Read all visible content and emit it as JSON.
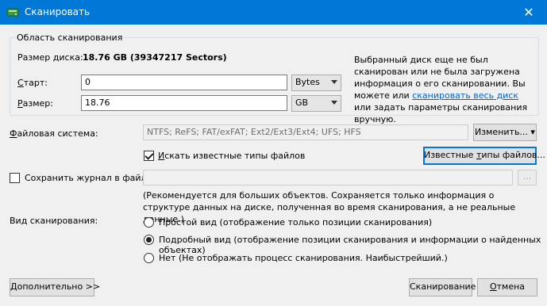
{
  "window": {
    "title": "Сканировать",
    "close_glyph": "✕"
  },
  "group": {
    "legend": "Область сканирования"
  },
  "disk": {
    "size_label": "Размер диска:",
    "size_value": "18.76 GB (39347217 Sectors)"
  },
  "start": {
    "label": "Старт:",
    "value": "0",
    "unit": "Bytes"
  },
  "size": {
    "label": "Размер:",
    "value": "18.76",
    "unit": "GB"
  },
  "info": {
    "before_link": "Выбранный диск еще не был сканирован или не была загружена информация о его сканировании. Вы можете или ",
    "link": "сканировать весь диск",
    "after_link": " или задать параметры сканирования вручную."
  },
  "filesystem": {
    "label": "Файловая система:",
    "value": "NTFS; ReFS; FAT/exFAT; Ext2/Ext3/Ext4; UFS; HFS",
    "change_button": "Изменить..."
  },
  "known_types": {
    "checkbox_label": "Искать известные типы файлов",
    "checked": true,
    "button": "Известные типы файлов..."
  },
  "log": {
    "checkbox_label": "Сохранить журнал в файл:",
    "checked": false,
    "value": "",
    "browse": "...",
    "note": "(Рекомендуется для больших объектов. Сохраняется только информация о структуре данных на диске, полученная во время сканирования, а не реальные данные.)"
  },
  "view": {
    "label": "Вид сканирования:",
    "options": [
      {
        "label": "Простой вид (отображение только позиции сканирования)",
        "selected": false
      },
      {
        "label": "Подробный вид (отображение позиции сканирования и информации о найденных объектах)",
        "selected": true
      },
      {
        "label": "Нет (Не отображать процесс сканирования. Наибыстрейший.)",
        "selected": false
      }
    ]
  },
  "footer": {
    "more_button": "Дополнительно >>",
    "scan_button": "Сканирование",
    "cancel_button": "Отмена"
  },
  "colors": {
    "titlebar": "#0078d7",
    "link": "#0066cc"
  }
}
